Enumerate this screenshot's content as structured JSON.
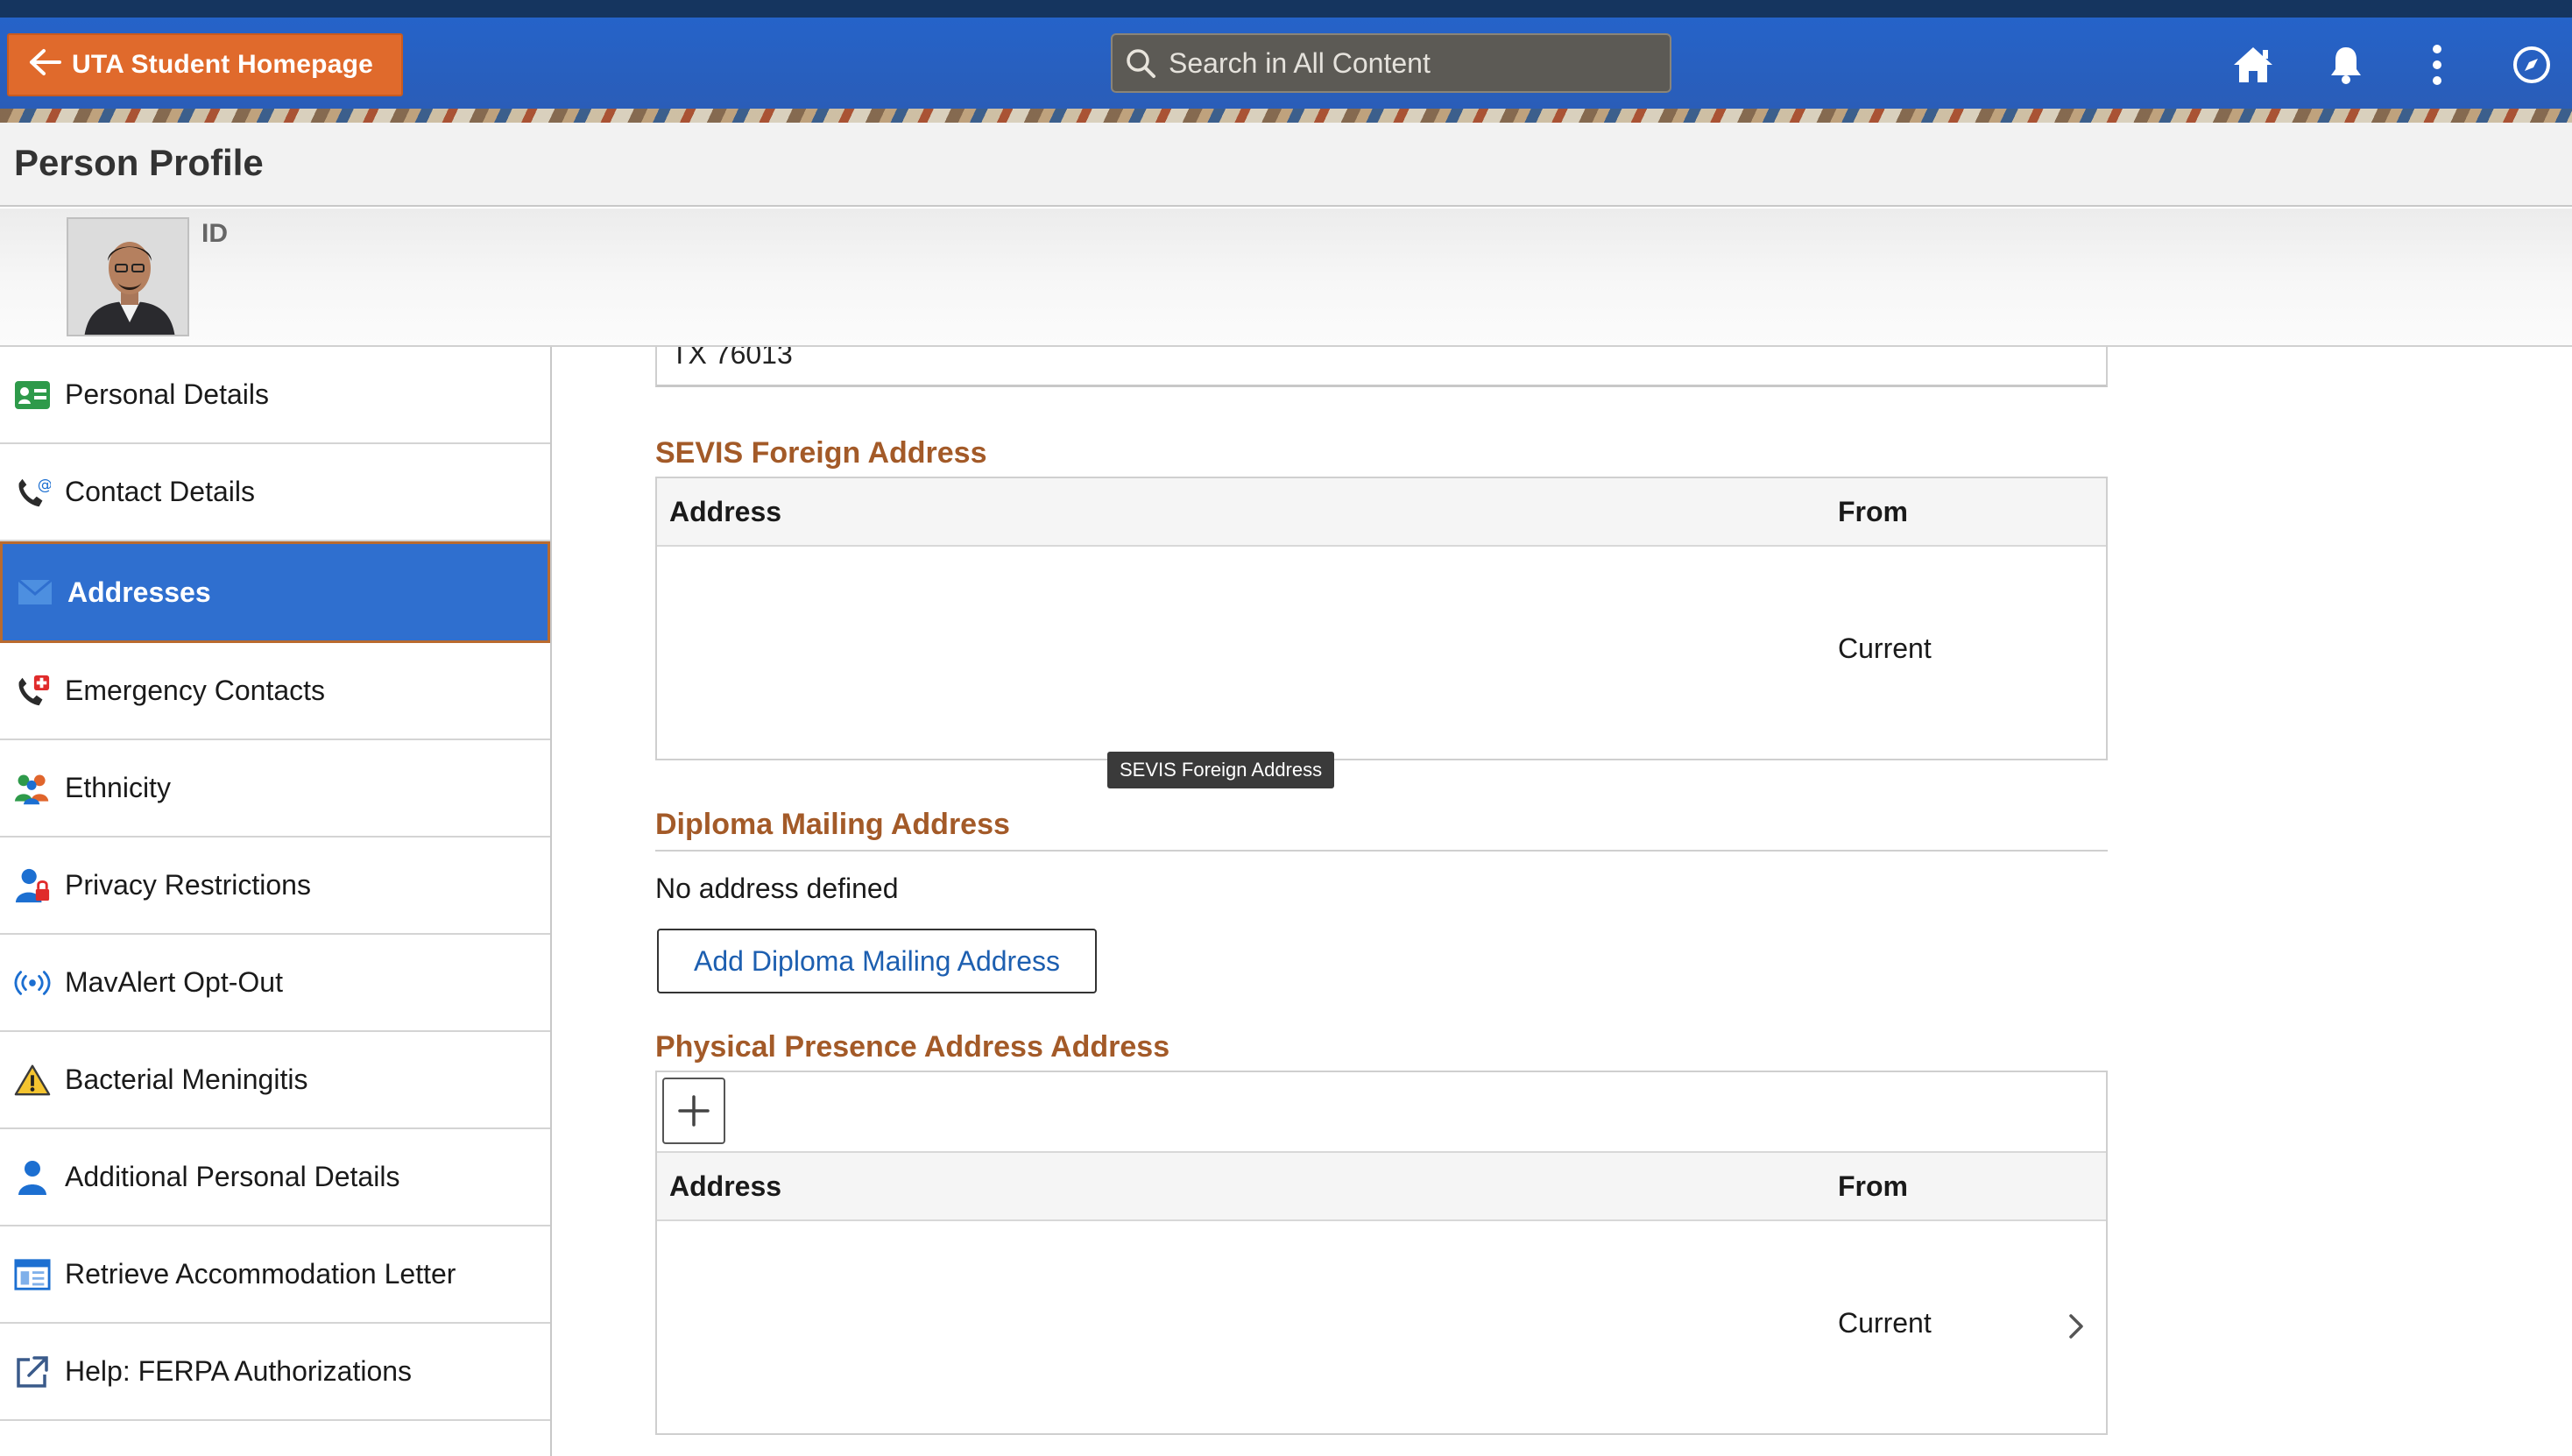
{
  "header": {
    "back_label": "UTA Student Homepage",
    "search_placeholder": "Search in All Content",
    "icons": [
      "home-icon",
      "bell-icon",
      "more-vertical-icon",
      "navigator-compass-icon"
    ]
  },
  "page": {
    "title": "Person Profile"
  },
  "profile": {
    "id_label": "ID"
  },
  "sidebar": {
    "items": [
      {
        "label": "Personal Details",
        "icon": "id-card-icon"
      },
      {
        "label": "Contact Details",
        "icon": "phone-at-icon"
      },
      {
        "label": "Addresses",
        "icon": "envelope-icon",
        "active": true
      },
      {
        "label": "Emergency Contacts",
        "icon": "phone-emergency-icon"
      },
      {
        "label": "Ethnicity",
        "icon": "people-group-icon"
      },
      {
        "label": "Privacy Restrictions",
        "icon": "person-lock-icon"
      },
      {
        "label": "MavAlert Opt-Out",
        "icon": "broadcast-icon"
      },
      {
        "label": "Bacterial Meningitis",
        "icon": "warning-icon"
      },
      {
        "label": "Additional Personal Details",
        "icon": "person-icon"
      },
      {
        "label": "Retrieve Accommodation Letter",
        "icon": "document-window-icon"
      },
      {
        "label": "Help: FERPA Authorizations",
        "icon": "external-link-icon"
      }
    ]
  },
  "content": {
    "previous_address_tail": "TX 76013",
    "sevis": {
      "title": "SEVIS Foreign Address",
      "col_address": "Address",
      "col_from": "From",
      "row_from": "Current",
      "tooltip": "SEVIS Foreign Address"
    },
    "diploma": {
      "title": "Diploma Mailing Address",
      "empty_text": "No address defined",
      "add_button": "Add Diploma Mailing Address"
    },
    "physical": {
      "title": "Physical Presence Address Address",
      "col_address": "Address",
      "col_from": "From",
      "row_from": "Current"
    }
  },
  "colors": {
    "banner_blue": "#2563c9",
    "home_button_orange": "#e06a2c",
    "active_nav_blue": "#2f6fcf",
    "section_title_brown": "#a35a28",
    "link_blue": "#1d5fb0",
    "annotation_red": "#e02b2b"
  }
}
